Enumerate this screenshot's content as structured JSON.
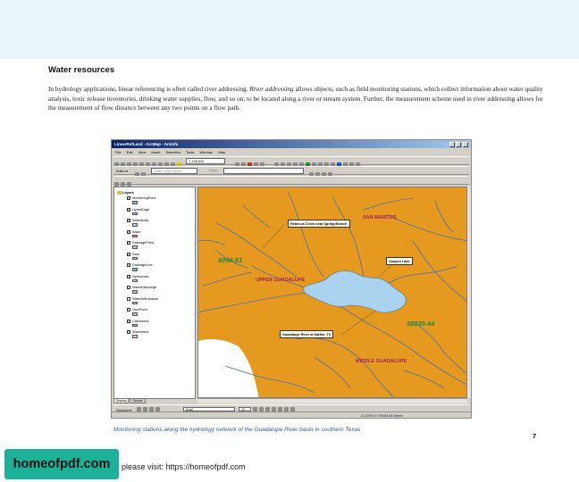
{
  "heading": "Water resources",
  "body": {
    "p1": "In hydrology applications, linear referencing is often called river addressing. ",
    "em": "River addressing",
    "p2": " allows objects, such as field monitoring stations, which collect information about water quality analysis, toxic release inventories, drinking water supplies, flow, and so on, to be located along a river or stream system. Further, the measurement scheme used in river addressing allows for the measurement of flow distance between any two points on a flow path."
  },
  "app": {
    "title": "LinearRefLand - ArcMap - ArcInfo",
    "menu": [
      "File",
      "Edit",
      "View",
      "Insert",
      "Selection",
      "Tools",
      "Window",
      "Help"
    ],
    "scale": "1:155,542",
    "editor_label": "Editor ▾",
    "task_label": "Create New Feature",
    "target_label": "Target:",
    "toc_root": "Layers",
    "layers": [
      {
        "name": "MonitoringPoint",
        "checked": true,
        "swatch": "#7fbfcf"
      },
      {
        "name": "HydroEdge",
        "checked": true,
        "swatch": "#9fc8e0"
      },
      {
        "name": "Waterbody",
        "checked": true,
        "swatch": "#a9d3ee"
      },
      {
        "name": "Basin",
        "checked": true,
        "swatch": "#e59a1f"
      },
      {
        "name": "DrainagePoint",
        "checked": true,
        "swatch": "#c0c0c0"
      },
      {
        "name": "Dam",
        "checked": true,
        "swatch": "#c0c0c0"
      },
      {
        "name": "DrainageLine",
        "checked": true,
        "swatch": "#8fb0d8"
      },
      {
        "name": "HydroArea",
        "checked": true,
        "swatch": "#b9dcee"
      },
      {
        "name": "WaterDischarge",
        "checked": false,
        "swatch": "#c0c0c0"
      },
      {
        "name": "WaterWithdrawal",
        "checked": false,
        "swatch": "#c0c0c0"
      },
      {
        "name": "UserPoint",
        "checked": false,
        "swatch": "#c0c0c0"
      },
      {
        "name": "Catchment",
        "checked": true,
        "swatch": "#d9a0c0"
      },
      {
        "name": "Watershed",
        "checked": true,
        "swatch": "#f0c0d0"
      }
    ],
    "toc_tabs": [
      "Display",
      "Source"
    ],
    "drawing_label": "Drawing ▾",
    "font_name": "Arial",
    "font_size": "10",
    "status_text": "-21.0299.02  794363.46 Meters"
  },
  "map": {
    "labels": {
      "san_marcos": "SAN MARCOS",
      "upper_guadalupe": "UPPER GUADALUPE",
      "middle_guadalupe": "MIDDLE GUADALUPE"
    },
    "measures": {
      "left": "6094.81",
      "right": "38239.44"
    },
    "callouts": {
      "rebecca": "Rebecca Creek near Spring Branch",
      "canyon": "Canyon Lake",
      "sattler": "Guadalupe River at Sattler, TX"
    },
    "colors": {
      "basin": "#e59a1f",
      "water": "#a9d3ee",
      "river": "#4a6fae",
      "label": "#a31e5a",
      "measure": "#1a8a3a"
    }
  },
  "caption": "Monitoring stations along the hydrology network of the Guadalupe River basin in southern Texas",
  "page_number": "7",
  "watermark": {
    "logo": "homeofpdf.com",
    "text": "please visit: https://homeofpdf.com"
  }
}
